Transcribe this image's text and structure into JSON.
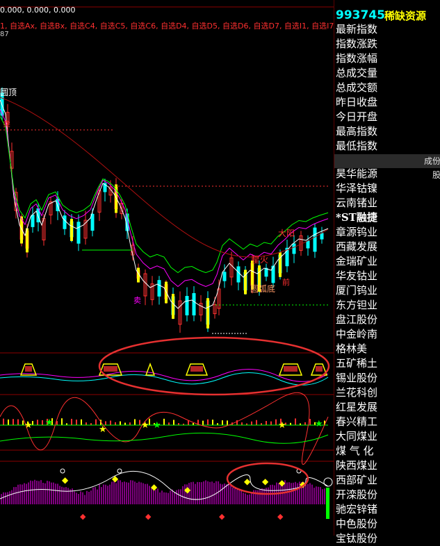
{
  "header": {
    "values_line": "0.000, 0.000, 0.000",
    "formula_line": "1, 自选Ax, 自选Bx, 自选C4, 自选C5, 自选C6, 自选D4, 自选D5, 自选D6, 自选D7, 自选I1, 自选I7, 自",
    "small_value": "87"
  },
  "pattern_label": "圆顶",
  "chart_labels": {
    "star_fire": "星火",
    "round_bottom": "圆弧底",
    "big_yang": "大阳",
    "sell": "卖",
    "buy_1": "卖",
    "buy_2": "前"
  },
  "sidebar": {
    "index_code": "993745",
    "index_name": "稀缺资源",
    "stats": [
      "最新指数",
      "指数涨跌",
      "指数涨幅",
      "总成交量",
      "总成交额",
      "昨日收盘",
      "今日开盘",
      "最高指数",
      "最低指数"
    ],
    "column_header": "成份股",
    "stocks": [
      "昊华能源",
      "华泽钴镍",
      "云南锗业",
      "*ST融捷",
      "章源钨业",
      "西藏发展",
      "金瑞矿业",
      "华友钴业",
      "厦门钨业",
      "东方钽业",
      "盘江股份",
      "中金岭南",
      "格林美",
      "五矿稀土",
      "锡业股份",
      "兰花科创",
      "红星发展",
      "春兴精工",
      "大同煤业",
      "煤 气 化",
      "陕西煤业",
      "西部矿业",
      "开滦股份",
      "驰宏锌锗",
      "中色股份",
      "宝钛股份"
    ]
  },
  "colors": {
    "up": "#ff3030",
    "down": "#00ffff",
    "yellow": "#ffff00",
    "green": "#00ff00",
    "magenta": "#ff00ff",
    "white": "#ffffff",
    "divider": "#8b0000",
    "highlight_circle": "#e53030"
  },
  "icons": [
    "flag-icon",
    "star-icon",
    "diamond-icon",
    "circle-marker-icon",
    "scroll-indicator-icon"
  ]
}
